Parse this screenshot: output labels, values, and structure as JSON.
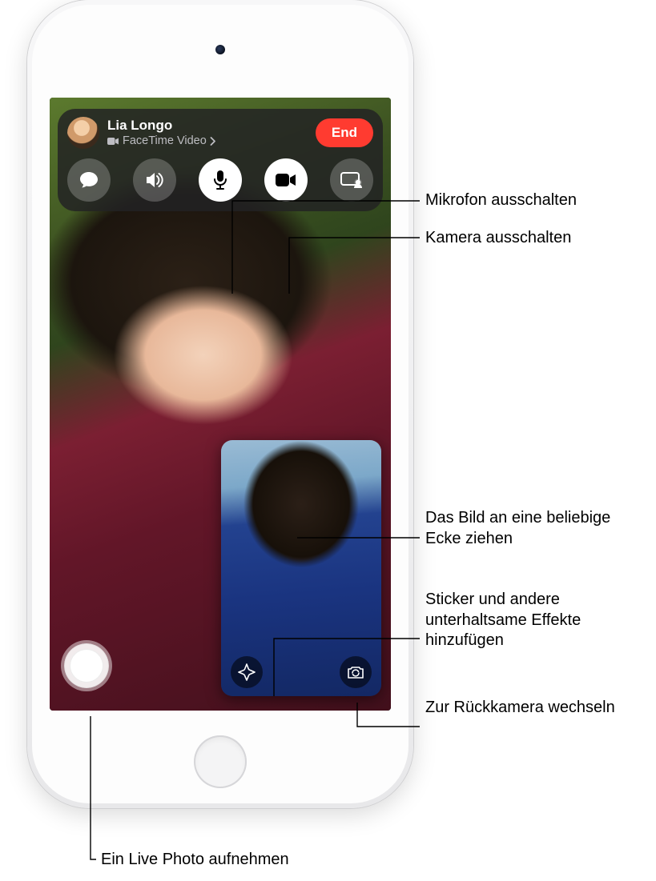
{
  "caller": {
    "name": "Lia Longo",
    "subtitle": "FaceTime Video",
    "end_label": "End"
  },
  "controls": {
    "messages": "messages",
    "speaker": "speaker",
    "mute_mic": "mute-microphone",
    "camera": "camera-toggle",
    "shareplay": "shareplay"
  },
  "pip_controls": {
    "effects": "effects",
    "flip": "flip-camera"
  },
  "callouts": {
    "mic_off": "Mikrofon ausschalten",
    "cam_off": "Kamera ausschalten",
    "drag_pip": "Das Bild an eine beliebige Ecke ziehen",
    "effects": "Sticker und andere unterhaltsame Effekte hinzufügen",
    "flip": "Zur Rückkamera wechseln",
    "live_photo": "Ein Live Photo aufnehmen"
  }
}
